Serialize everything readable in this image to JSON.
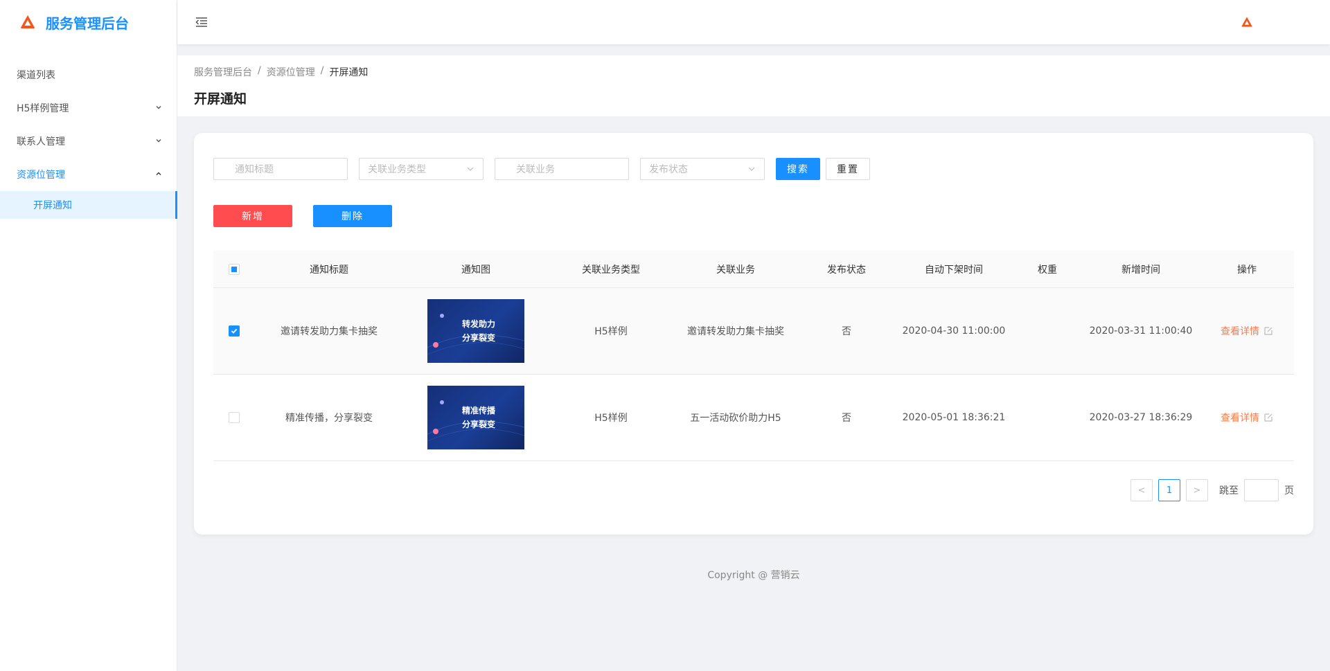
{
  "app": {
    "title": "服务管理后台",
    "brand_color": "#1890ff",
    "logo_color": "#f5541b"
  },
  "sidebar": {
    "items": [
      {
        "label": "渠道列表"
      },
      {
        "label": "H5样例管理",
        "arrow": "⌄"
      },
      {
        "label": "联系人管理",
        "arrow": "⌄"
      },
      {
        "label": "资源位管理",
        "arrow": "⌃"
      }
    ],
    "sub_items": [
      {
        "label": "开屏通知"
      }
    ]
  },
  "breadcrumb": {
    "items": [
      "服务管理后台",
      "资源位管理",
      "开屏通知"
    ],
    "separator": "/"
  },
  "page": {
    "title": "开屏通知"
  },
  "filters": {
    "title_placeholder": "通知标题",
    "biz_type_placeholder": "关联业务类型",
    "biz_placeholder": "关联业务",
    "status_placeholder": "发布状态",
    "search_label": "搜索",
    "reset_label": "重置"
  },
  "actions": {
    "add_label": "新增",
    "delete_label": "删除"
  },
  "table": {
    "columns": [
      "通知标题",
      "通知图",
      "关联业务类型",
      "关联业务",
      "发布状态",
      "自动下架时间",
      "权重",
      "新增时间",
      "操作"
    ],
    "rows": [
      {
        "title": "邀请转发助力集卡抽奖",
        "image_text": [
          "转发助力",
          "分享裂变"
        ],
        "biz_type": "H5样例",
        "biz": "邀请转发助力集卡抽奖",
        "status": "否",
        "auto_off_time": "2020-04-30 11:00:00",
        "weight": "",
        "created_time": "2020-03-31 11:00:40",
        "action": "查看详情",
        "checked": true
      },
      {
        "title": "精准传播，分享裂变",
        "image_text": [
          "精准传播",
          "分享裂变"
        ],
        "biz_type": "H5样例",
        "biz": "五一活动砍价助力H5",
        "status": "否",
        "auto_off_time": "2020-05-01 18:36:21",
        "weight": "",
        "created_time": "2020-03-27 18:36:29",
        "action": "查看详情",
        "checked": false
      }
    ]
  },
  "pagination": {
    "current_page": "1",
    "jump_label": "跳至",
    "page_suffix": "页",
    "prev": "<",
    "next": ">"
  },
  "footer": {
    "copyright": "Copyright @ 营销云"
  }
}
